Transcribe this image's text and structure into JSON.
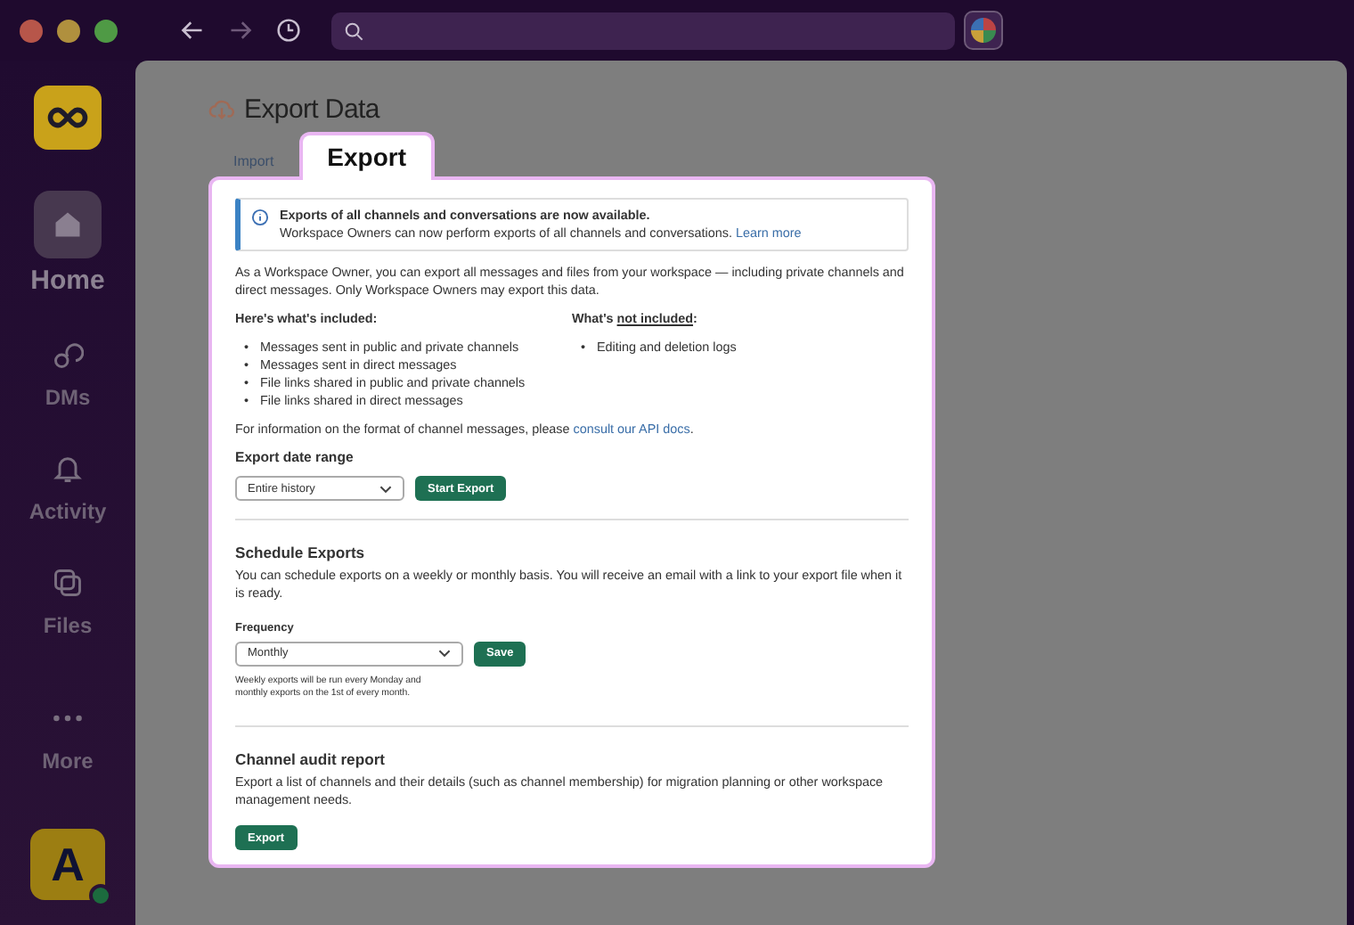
{
  "sidebar": {
    "workspace_initial": "A",
    "items": [
      {
        "kind": "home",
        "label": "Home",
        "selected": true
      },
      {
        "kind": "dms",
        "label": "DMs",
        "selected": false
      },
      {
        "kind": "activity",
        "label": "Activity",
        "selected": false
      },
      {
        "kind": "files",
        "label": "Files",
        "selected": false
      },
      {
        "kind": "more",
        "label": "More",
        "selected": false
      }
    ]
  },
  "page": {
    "title": "Export Data",
    "tabs": [
      {
        "label": "Import",
        "selected": false
      },
      {
        "label": "Export",
        "selected": true
      }
    ]
  },
  "banner": {
    "title": "Exports of all channels and conversations are now available.",
    "text": "Workspace Owners can now perform exports of all channels and conversations.",
    "link": "Learn more"
  },
  "intro": "As a Workspace Owner, you can export all messages and files from your workspace — including private channels and direct messages. Only Workspace Owners may export this data.",
  "included": {
    "heading": "Here's what's included:",
    "items": [
      "Messages sent in public and private channels",
      "Messages sent in direct messages",
      "File links shared in public and private channels",
      "File links shared in direct messages"
    ]
  },
  "bullet": "•",
  "not_included": {
    "heading": {
      "before": "What's ",
      "underlined": "not included",
      "after": ":"
    },
    "items": [
      "Editing and deletion logs"
    ]
  },
  "format_note": {
    "text": "For information on the format of channel messages, please ",
    "link": "consult our API docs",
    "after": "."
  },
  "date_range": {
    "label": "Export date range",
    "value": "Entire history",
    "button": "Start Export"
  },
  "schedule": {
    "title": "Schedule Exports",
    "text": "You can schedule exports on a weekly or monthly basis. You will receive an email with a link to your export file when it is ready.",
    "label": "Frequency",
    "value": "Monthly",
    "button": "Save",
    "hint": "Weekly exports will be run every Monday and monthly exports on the 1st of every month."
  },
  "audit": {
    "title": "Channel audit report",
    "text": "Export a list of channels and their details (such as channel membership) for migration planning or other workspace management needs.",
    "button": "Export"
  }
}
